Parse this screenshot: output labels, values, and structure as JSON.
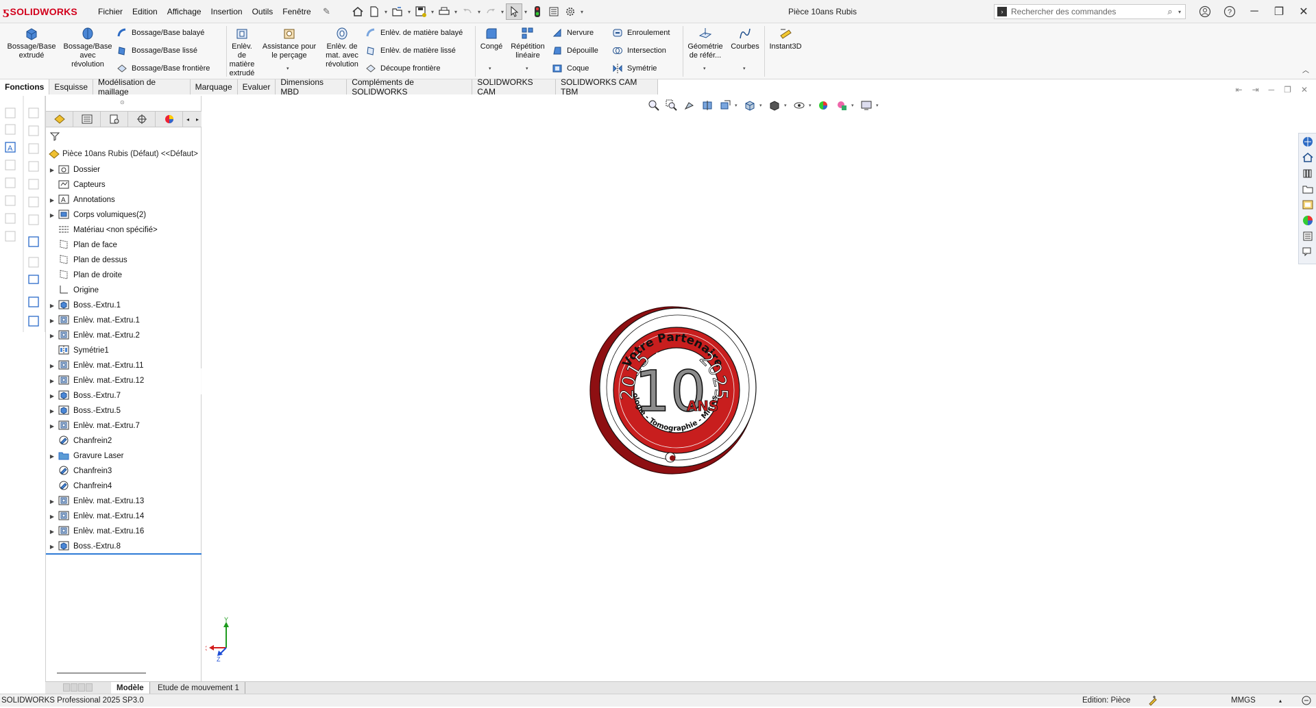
{
  "app": {
    "name": "SOLIDWORKS",
    "doc_title": "Pièce 10ans Rubis"
  },
  "menus": [
    "Fichier",
    "Edition",
    "Affichage",
    "Insertion",
    "Outils",
    "Fenêtre"
  ],
  "search": {
    "placeholder": "Rechercher des commandes"
  },
  "ribbon": {
    "big": [
      {
        "label": "Bossage/Base\nextrudé",
        "icon": "extruded-boss-icon"
      },
      {
        "label": "Bossage/Base\navec\nrévolution",
        "icon": "revolved-boss-icon"
      },
      {
        "label": "Enlèv.\nde\nmatière\nextrudé",
        "icon": "extruded-cut-icon"
      },
      {
        "label": "Assistance pour\nle perçage",
        "icon": "hole-wizard-icon"
      },
      {
        "label": "Enlèv. de\nmat. avec\nrévolution",
        "icon": "revolved-cut-icon"
      },
      {
        "label": "Congé",
        "icon": "fillet-icon"
      },
      {
        "label": "Répétition\nlinéaire",
        "icon": "linear-pattern-icon"
      },
      {
        "label": "Géométrie\nde référ...",
        "icon": "reference-geometry-icon"
      },
      {
        "label": "Courbes",
        "icon": "curves-icon"
      },
      {
        "label": "Instant3D",
        "icon": "instant3d-icon"
      }
    ],
    "small": [
      {
        "label": "Bossage/Base balayé",
        "icon": "swept-boss-icon"
      },
      {
        "label": "Bossage/Base lissé",
        "icon": "lofted-boss-icon"
      },
      {
        "label": "Bossage/Base frontière",
        "icon": "boundary-boss-icon"
      },
      {
        "label": "Enlèv. de matière balayé",
        "icon": "swept-cut-icon"
      },
      {
        "label": "Enlèv. de matière lissé",
        "icon": "lofted-cut-icon"
      },
      {
        "label": "Découpe frontière",
        "icon": "boundary-cut-icon"
      },
      {
        "label": "Nervure",
        "icon": "rib-icon"
      },
      {
        "label": "Dépouille",
        "icon": "draft-icon"
      },
      {
        "label": "Coque",
        "icon": "shell-icon"
      },
      {
        "label": "Enroulement",
        "icon": "wrap-icon"
      },
      {
        "label": "Intersection",
        "icon": "intersect-icon"
      },
      {
        "label": "Symétrie",
        "icon": "mirror-icon"
      }
    ]
  },
  "tabs": [
    "Fonctions",
    "Esquisse",
    "Modélisation de maillage",
    "Marquage",
    "Evaluer",
    "Dimensions MBD",
    "Compléments de SOLIDWORKS",
    "SOLIDWORKS CAM",
    "SOLIDWORKS CAM TBM"
  ],
  "active_tab": "Fonctions",
  "feature_tree": {
    "root": "Pièce 10ans Rubis (Défaut) <<Défaut>",
    "items": [
      {
        "label": "Dossier",
        "expandable": true,
        "icon": "folder-sensors-icon"
      },
      {
        "label": "Capteurs",
        "expandable": false,
        "icon": "sensors-icon"
      },
      {
        "label": "Annotations",
        "expandable": true,
        "icon": "annotations-icon"
      },
      {
        "label": "Corps volumiques(2)",
        "expandable": true,
        "icon": "solid-bodies-icon"
      },
      {
        "label": "Matériau <non spécifié>",
        "expandable": false,
        "icon": "material-icon"
      },
      {
        "label": "Plan de face",
        "expandable": false,
        "icon": "plane-icon"
      },
      {
        "label": "Plan de dessus",
        "expandable": false,
        "icon": "plane-icon"
      },
      {
        "label": "Plan de droite",
        "expandable": false,
        "icon": "plane-icon"
      },
      {
        "label": "Origine",
        "expandable": false,
        "icon": "origin-icon"
      },
      {
        "label": "Boss.-Extru.1",
        "expandable": true,
        "icon": "boss-extrude-icon"
      },
      {
        "label": "Enlèv. mat.-Extru.1",
        "expandable": true,
        "icon": "cut-extrude-icon"
      },
      {
        "label": "Enlèv. mat.-Extru.2",
        "expandable": true,
        "icon": "cut-extrude-icon"
      },
      {
        "label": "Symétrie1",
        "expandable": false,
        "icon": "mirror-feature-icon"
      },
      {
        "label": "Enlèv. mat.-Extru.11",
        "expandable": true,
        "icon": "cut-extrude-icon"
      },
      {
        "label": "Enlèv. mat.-Extru.12",
        "expandable": true,
        "icon": "cut-extrude-icon"
      },
      {
        "label": "Boss.-Extru.7",
        "expandable": true,
        "icon": "boss-extrude-icon"
      },
      {
        "label": "Boss.-Extru.5",
        "expandable": true,
        "icon": "boss-extrude-icon"
      },
      {
        "label": "Enlèv. mat.-Extru.7",
        "expandable": true,
        "icon": "cut-extrude-icon"
      },
      {
        "label": "Chanfrein2",
        "expandable": false,
        "icon": "chamfer-icon"
      },
      {
        "label": "Gravure Laser",
        "expandable": true,
        "icon": "folder-icon"
      },
      {
        "label": "Chanfrein3",
        "expandable": false,
        "icon": "chamfer-icon"
      },
      {
        "label": "Chanfrein4",
        "expandable": false,
        "icon": "chamfer-icon"
      },
      {
        "label": "Enlèv. mat.-Extru.13",
        "expandable": true,
        "icon": "cut-extrude-icon"
      },
      {
        "label": "Enlèv. mat.-Extru.14",
        "expandable": true,
        "icon": "cut-extrude-icon"
      },
      {
        "label": "Enlèv. mat.-Extru.16",
        "expandable": true,
        "icon": "cut-extrude-icon"
      },
      {
        "label": "Boss.-Extru.8",
        "expandable": true,
        "icon": "boss-extrude-icon"
      }
    ]
  },
  "model": {
    "text_top": "Votre Partenaire",
    "text_ring": "depuis",
    "year_left": "2015",
    "year_right": "2025",
    "big_number": "10",
    "ans": "ANS",
    "text_bottom": "Métrologie - Tomographie - Microscopie",
    "red": "#c81e1e",
    "dark_red": "#8e0f12"
  },
  "triad": {
    "y": "Y",
    "x": "X",
    "z": "Z"
  },
  "bottom_tabs": [
    "Modèle",
    "Etude de mouvement 1"
  ],
  "status": {
    "product": "SOLIDWORKS Professional 2025 SP3.0",
    "edition": "Edition: Pièce",
    "units": "MMGS"
  }
}
